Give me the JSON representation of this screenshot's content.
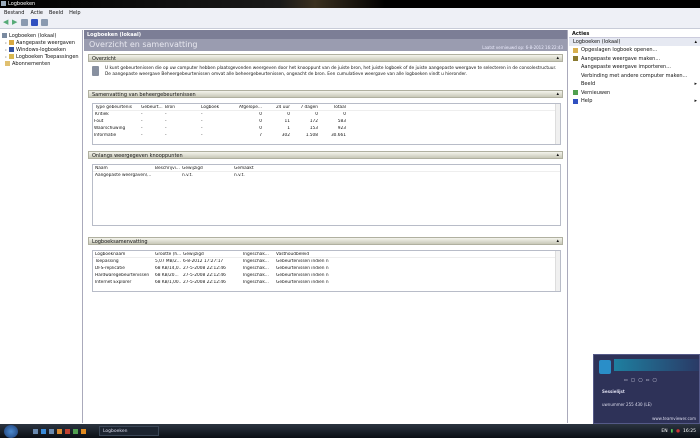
{
  "window": {
    "title": "Logboeken"
  },
  "menu": [
    "Bestand",
    "Actie",
    "Beeld",
    "Help"
  ],
  "tree": [
    {
      "label": "Logboeken (lokaal)",
      "color": "#7a8aa0"
    },
    {
      "label": "Aangepaste weergaven",
      "color": "#d8a840"
    },
    {
      "label": "Windows-logboeken",
      "color": "#3050a0"
    },
    {
      "label": "Logboeken Toepassingen en services",
      "color": "#d8b850"
    },
    {
      "label": "Abonnementen",
      "color": "#e0c070"
    }
  ],
  "center": {
    "header": "Logboeken (lokaal)",
    "title": "Overzicht en samenvatting",
    "refreshed": "Laatst vernieuwd op: 6-8-2012 16:22:43",
    "overview": {
      "label": "Overzicht",
      "text": "U kunt gebeurtenissen die op uw computer hebben plaatsgevonden weergeven door het knooppunt van de juiste bron, het juiste logboek of de juiste aangepaste weergave te selecteren in de consolestructuur. De aangepaste weergave Beheergebeurtenissen omvat alle beheergebeurtenissen, ongeacht de bron. Een cumulatieve weergave van alle logboeken vindt u hieronder."
    },
    "summary": {
      "label": "Samenvatting van beheergebeurtenissen",
      "columns": [
        "Type gebeurtenis",
        "Gebeurt...",
        "Bron",
        "Logboek",
        "Afgelope...",
        "24 uur",
        "7 dagen",
        "Totaal"
      ],
      "rows": [
        [
          "Kritiek",
          "-",
          "-",
          "-",
          "0",
          "0",
          "0",
          "0"
        ],
        [
          "Fout",
          "-",
          "-",
          "-",
          "0",
          "11",
          "172",
          "583"
        ],
        [
          "Waarschuwing",
          "-",
          "-",
          "-",
          "0",
          "1",
          "153",
          "923"
        ],
        [
          "Informatie",
          "-",
          "-",
          "-",
          "7",
          "302",
          "1.508",
          "30.661"
        ]
      ]
    },
    "recent": {
      "label": "Onlangs weergegeven knooppunten",
      "columns": [
        "Naam",
        "Beschrijvi...",
        "Gewijzigd",
        "Gemaakt"
      ],
      "rows": [
        [
          "Aangepaste weergaven\\...",
          "",
          "n.v.t.",
          "n.v.t."
        ]
      ]
    },
    "logsummary": {
      "label": "Logboeksamenvatting",
      "columns": [
        "Logboeknaam",
        "Grootte (h...",
        "Gewijzigd",
        "Ingeschak...",
        "Vasthoudbeleid"
      ],
      "rows": [
        [
          "Toepassing",
          "5,07 MB/2...",
          "6-8-2012 17:27:17",
          "Ingeschak...",
          "Gebeurtenissen indien n..."
        ],
        [
          "DFS-replicatie",
          "68 KB/14,0...",
          "27-5-2008 22:12:46",
          "Ingeschak...",
          "Gebeurtenissen indien n..."
        ],
        [
          "Hardwaregebeurtenissen",
          "68 KB/20...",
          "27-5-2008 22:12:46",
          "Ingeschak...",
          "Gebeurtenissen indien n..."
        ],
        [
          "Internet Explorer",
          "68 KB/1,00...",
          "27-5-2008 22:12:46",
          "Ingeschak...",
          "Gebeurtenissen indien n..."
        ]
      ]
    }
  },
  "actions": {
    "header": "Acties",
    "section": "Logboeken (lokaal)",
    "items": [
      {
        "label": "Opgeslagen logboek openen...",
        "icon": "folder-icon",
        "color": "#d8b050",
        "arrow": false
      },
      {
        "label": "Aangepaste weergave maken...",
        "icon": "filter-icon",
        "color": "#8a7a30",
        "arrow": false
      },
      {
        "label": "Aangepaste weergave importeren...",
        "icon": "",
        "color": "",
        "arrow": false
      },
      {
        "label": "Verbinding met andere computer maken...",
        "icon": "",
        "color": "",
        "arrow": false
      },
      {
        "label": "Beeld",
        "icon": "",
        "color": "",
        "arrow": true
      },
      {
        "label": "Vernieuwen",
        "icon": "refresh-icon",
        "color": "#50a050",
        "arrow": false
      },
      {
        "label": "Help",
        "icon": "help-icon",
        "color": "#3050c0",
        "arrow": true
      }
    ]
  },
  "taskbar": {
    "task": "Logboeken",
    "lang": "EN",
    "clock": "16:25"
  },
  "teamviewer": {
    "section": "Sessielijst",
    "id": "uwnummer 255 430 (LE)",
    "url": "www.teamviewer.com"
  }
}
